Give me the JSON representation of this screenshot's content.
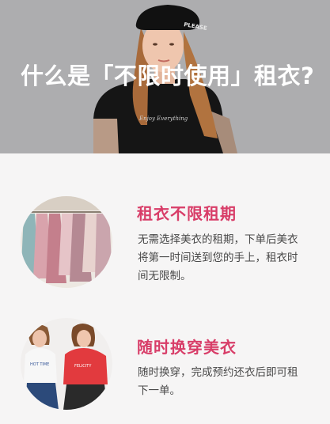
{
  "hero": {
    "title": "什么是「不限时使用」租衣?",
    "image": "model-photo-black-beret-t-shirt",
    "cap_text": "PLEASE",
    "shirt_text": "Enjoy Everything"
  },
  "features": [
    {
      "title": "租衣不限租期",
      "description": "无需选择美衣的租期，下单后美衣将第一时间送到您的手上，租衣时间无限制。",
      "image": "clothes-rack-dresses-photo"
    },
    {
      "title": "随时换穿美衣",
      "description": "随时换穿，完成预约还衣后即可租下一单。",
      "image": "two-models-outfits-photo"
    }
  ],
  "colors": {
    "accent": "#d83d68",
    "hero_bg": "#adadaf",
    "page_bg": "#f6f5f5",
    "body_text": "#484848"
  }
}
